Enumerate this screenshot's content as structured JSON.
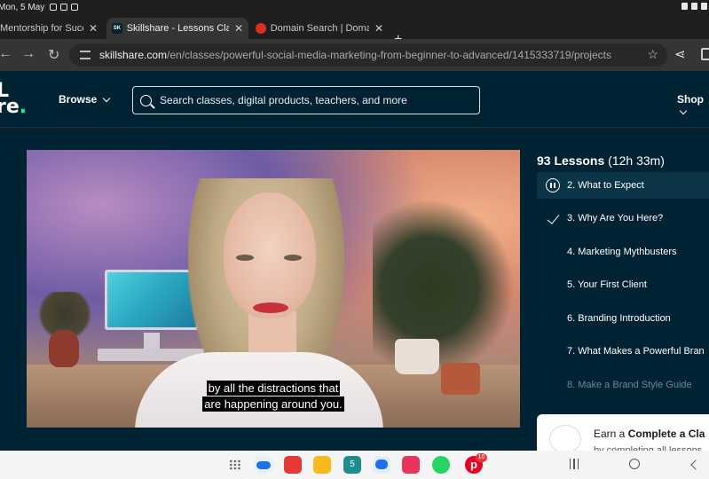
{
  "status_bar": {
    "time": "Mon, 5 May"
  },
  "tabs": [
    {
      "title": "Mentorship for Success |",
      "active": false
    },
    {
      "title": "Skillshare - Lessons Clas",
      "favicon_text": "SK",
      "active": true
    },
    {
      "title": "Domain Search | Domain",
      "active": false
    }
  ],
  "address_bar": {
    "url_host": "skillshare.com",
    "url_path": "/en/classes/powerful-social-media-marketing-from-beginner-to-advanced/1415333719/projects"
  },
  "site_header": {
    "logo_top": "L",
    "logo_bottom": "re",
    "logo_dot": ".",
    "browse_label": "Browse",
    "search_placeholder": "Search classes, digital products, teachers, and more",
    "shop_label": "Shop"
  },
  "video": {
    "caption_line1": "by all the distractions that",
    "caption_line2": "are happening around you."
  },
  "lessons": {
    "count_label": "93 Lessons",
    "duration": "(12h 33m)",
    "items": [
      {
        "label": "2.  What to Expect",
        "state": "playing"
      },
      {
        "label": "3.  Why Are You Here?",
        "state": "completed"
      },
      {
        "label": "4.  Marketing Mythbusters",
        "state": "default"
      },
      {
        "label": "5.  Your First Client",
        "state": "default"
      },
      {
        "label": "6.  Branding Introduction",
        "state": "default"
      },
      {
        "label": "7.  What Makes a Powerful Bran",
        "state": "default"
      },
      {
        "label": "8.  Make a Brand Style Guide",
        "state": "dim"
      }
    ]
  },
  "earn_card": {
    "prefix": "Earn a ",
    "bold": "Complete a Cla",
    "subtext": "by completing all lessons"
  },
  "taskbar": {
    "apps": [
      "apps-grid-icon",
      "cloud-icon",
      "notes-icon",
      "folder-icon",
      "calendar-icon",
      "chat-icon",
      "gallery-icon",
      "whatsapp-icon",
      "pinterest-icon"
    ],
    "calendar_day": "5",
    "pinterest_badge": "10"
  },
  "colors": {
    "brand_bg": "#002333",
    "brand_accent": "#00ff84",
    "active_lesson_bg": "#0b3546"
  }
}
